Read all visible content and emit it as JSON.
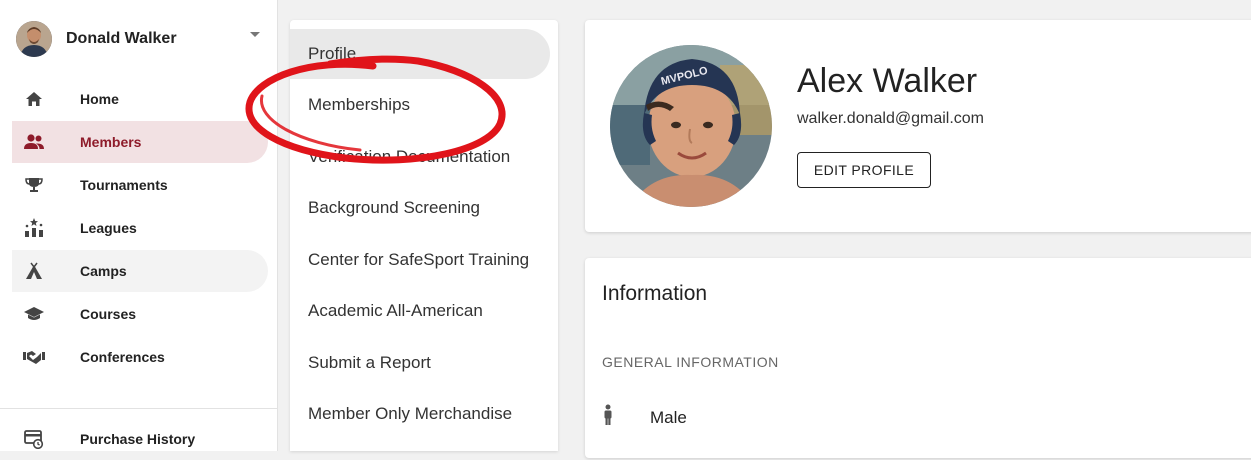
{
  "user": {
    "name": "Donald Walker"
  },
  "nav": {
    "items": [
      {
        "label": "Home",
        "icon": "home-icon"
      },
      {
        "label": "Members",
        "icon": "members-icon"
      },
      {
        "label": "Tournaments",
        "icon": "trophy-icon"
      },
      {
        "label": "Leagues",
        "icon": "leagues-icon"
      },
      {
        "label": "Camps",
        "icon": "camp-tent-icon"
      },
      {
        "label": "Courses",
        "icon": "graduation-cap-icon"
      },
      {
        "label": "Conferences",
        "icon": "handshake-icon"
      }
    ],
    "footer_items": [
      {
        "label": "Purchase History",
        "icon": "purchase-history-icon"
      }
    ],
    "active": "Members",
    "accent_color": "#8e1b2a",
    "active_bg": "#f2e1e3"
  },
  "submenu": {
    "items": [
      "Profile",
      "Memberships",
      "Verification Documentation",
      "Background Screening",
      "Center for SafeSport Training",
      "Academic All-American",
      "Submit a Report",
      "Member Only Merchandise"
    ],
    "active": "Profile"
  },
  "profile": {
    "name": "Alex Walker",
    "email": "walker.donald@gmail.com",
    "edit_button": "EDIT PROFILE",
    "cap_text": "MVPOLO"
  },
  "info": {
    "title": "Information",
    "section": "GENERAL INFORMATION",
    "gender": "Male"
  },
  "annotation": {
    "color": "#e0141a"
  }
}
